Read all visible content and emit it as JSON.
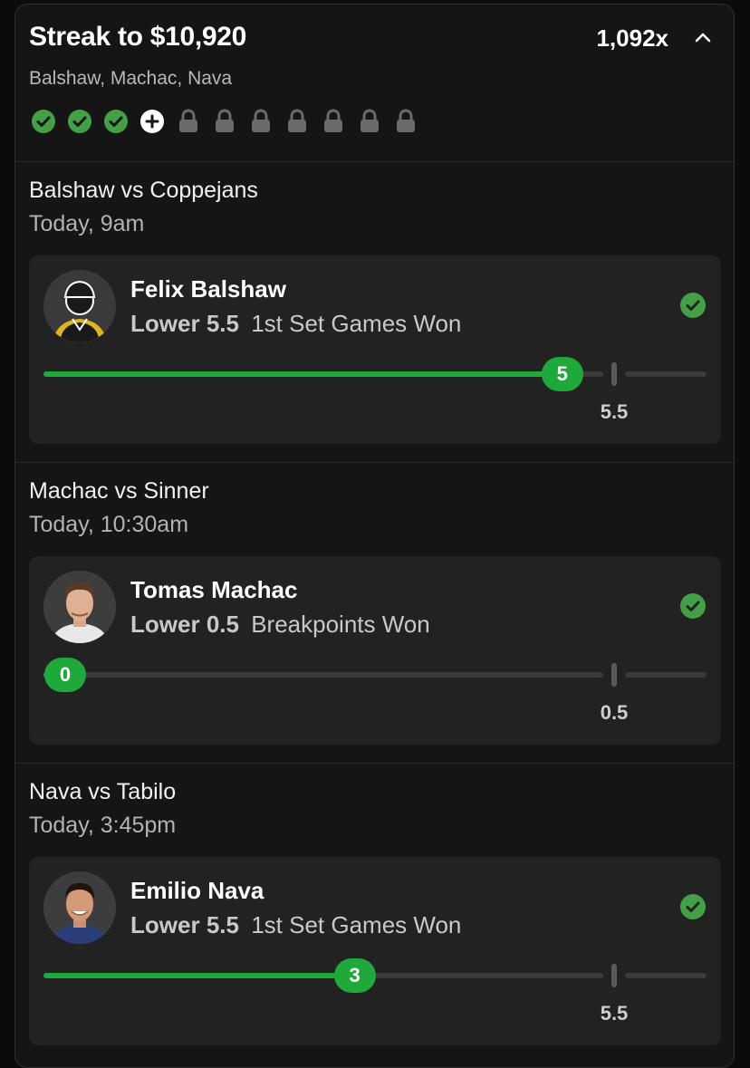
{
  "header": {
    "title": "Streak to $10,920",
    "multiplier": "1,092x",
    "players": "Balshaw, Machac, Nava",
    "collapse_icon": "chevron-up-icon"
  },
  "progress": {
    "steps": [
      "won",
      "won",
      "won",
      "add",
      "locked",
      "locked",
      "locked",
      "locked",
      "locked",
      "locked",
      "locked"
    ],
    "colors": {
      "won": "#43a047",
      "add": "#ffffff",
      "locked": "#6a6a6a"
    }
  },
  "colors": {
    "accent": "#1ea93a",
    "card": "#222222",
    "background": "#151515"
  },
  "matches": [
    {
      "title": "Balshaw vs Coppejans",
      "time": "Today, 9am",
      "player": "Felix Balshaw",
      "direction": "Lower",
      "line": "5.5",
      "stat": "1st Set Games Won",
      "result": "5",
      "result_value": 5,
      "line_value": 5.5,
      "avatar": "placeholder-silhouette"
    },
    {
      "title": "Machac vs Sinner",
      "time": "Today, 10:30am",
      "player": "Tomas Machac",
      "direction": "Lower",
      "line": "0.5",
      "stat": "Breakpoints Won",
      "result": "0",
      "result_value": 0,
      "line_value": 0.5,
      "avatar": "player-photo"
    },
    {
      "title": "Nava vs Tabilo",
      "time": "Today, 3:45pm",
      "player": "Emilio Nava",
      "direction": "Lower",
      "line": "5.5",
      "stat": "1st Set Games Won",
      "result": "3",
      "result_value": 3,
      "line_value": 5.5,
      "avatar": "player-photo"
    }
  ]
}
